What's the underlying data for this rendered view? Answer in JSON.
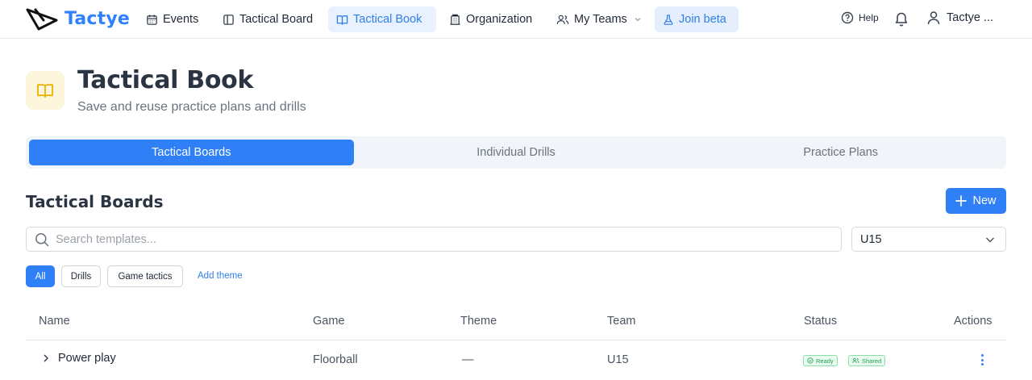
{
  "app": {
    "name": "Tactye"
  },
  "nav": {
    "items": [
      {
        "label": "Events",
        "icon": "calendar-icon"
      },
      {
        "label": "Tactical Board",
        "icon": "board-icon"
      },
      {
        "label": "Tactical Book",
        "icon": "book-icon",
        "active": true
      },
      {
        "label": "Organization",
        "icon": "building-icon"
      },
      {
        "label": "My Teams",
        "icon": "users-icon"
      },
      {
        "label": "Join beta",
        "icon": "flask-icon"
      }
    ],
    "help_label": "Help",
    "user_label": "Tactye ..."
  },
  "page": {
    "title": "Tactical Book",
    "subtitle": "Save and reuse practice plans and drills",
    "icon": "book-icon"
  },
  "tabs": [
    {
      "label": "Tactical Boards",
      "active": true
    },
    {
      "label": "Individual Drills",
      "active": false
    },
    {
      "label": "Practice Plans",
      "active": false
    }
  ],
  "section": {
    "title": "Tactical Boards",
    "new_label": "New"
  },
  "search": {
    "placeholder": "Search templates...",
    "value": ""
  },
  "team_filter": {
    "selected": "U15"
  },
  "filters": {
    "chips": [
      "All",
      "Drills",
      "Game tactics"
    ],
    "active": "All",
    "add_label": "Add theme"
  },
  "table": {
    "columns": [
      "Name",
      "Game",
      "Theme",
      "Team",
      "Status",
      "Actions"
    ],
    "rows": [
      {
        "name": "Power play",
        "game": "Floorball",
        "theme": "—",
        "team": "U15",
        "badges": [
          "Ready",
          "Shared"
        ]
      }
    ]
  },
  "colors": {
    "accent": "#2f80f7",
    "active_nav_bg": "#e8f1fd",
    "page_icon_bg": "#fdf6dd",
    "page_icon": "#e6b400",
    "badge_green": "#1f9d55"
  }
}
